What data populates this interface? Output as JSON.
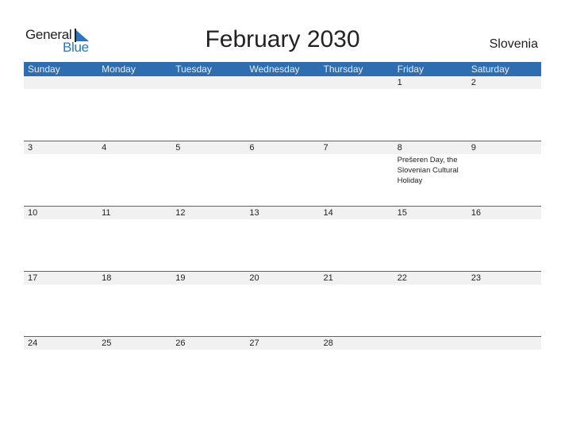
{
  "logo": {
    "line1": "General",
    "line2": "Blue"
  },
  "title": "February 2030",
  "country": "Slovenia",
  "colors": {
    "accent": "#2e6eb0",
    "row_bg": "#f1f1f1"
  },
  "weekdays": [
    "Sunday",
    "Monday",
    "Tuesday",
    "Wednesday",
    "Thursday",
    "Friday",
    "Saturday"
  ],
  "weeks": [
    {
      "days": [
        "",
        "",
        "",
        "",
        "",
        "1",
        "2"
      ],
      "notes": [
        "",
        "",
        "",
        "",
        "",
        "",
        ""
      ]
    },
    {
      "days": [
        "3",
        "4",
        "5",
        "6",
        "7",
        "8",
        "9"
      ],
      "notes": [
        "",
        "",
        "",
        "",
        "",
        "Prešeren Day, the Slovenian Cultural Holiday",
        ""
      ]
    },
    {
      "days": [
        "10",
        "11",
        "12",
        "13",
        "14",
        "15",
        "16"
      ],
      "notes": [
        "",
        "",
        "",
        "",
        "",
        "",
        ""
      ]
    },
    {
      "days": [
        "17",
        "18",
        "19",
        "20",
        "21",
        "22",
        "23"
      ],
      "notes": [
        "",
        "",
        "",
        "",
        "",
        "",
        ""
      ]
    },
    {
      "days": [
        "24",
        "25",
        "26",
        "27",
        "28",
        "",
        ""
      ],
      "notes": [
        "",
        "",
        "",
        "",
        "",
        "",
        ""
      ]
    }
  ]
}
